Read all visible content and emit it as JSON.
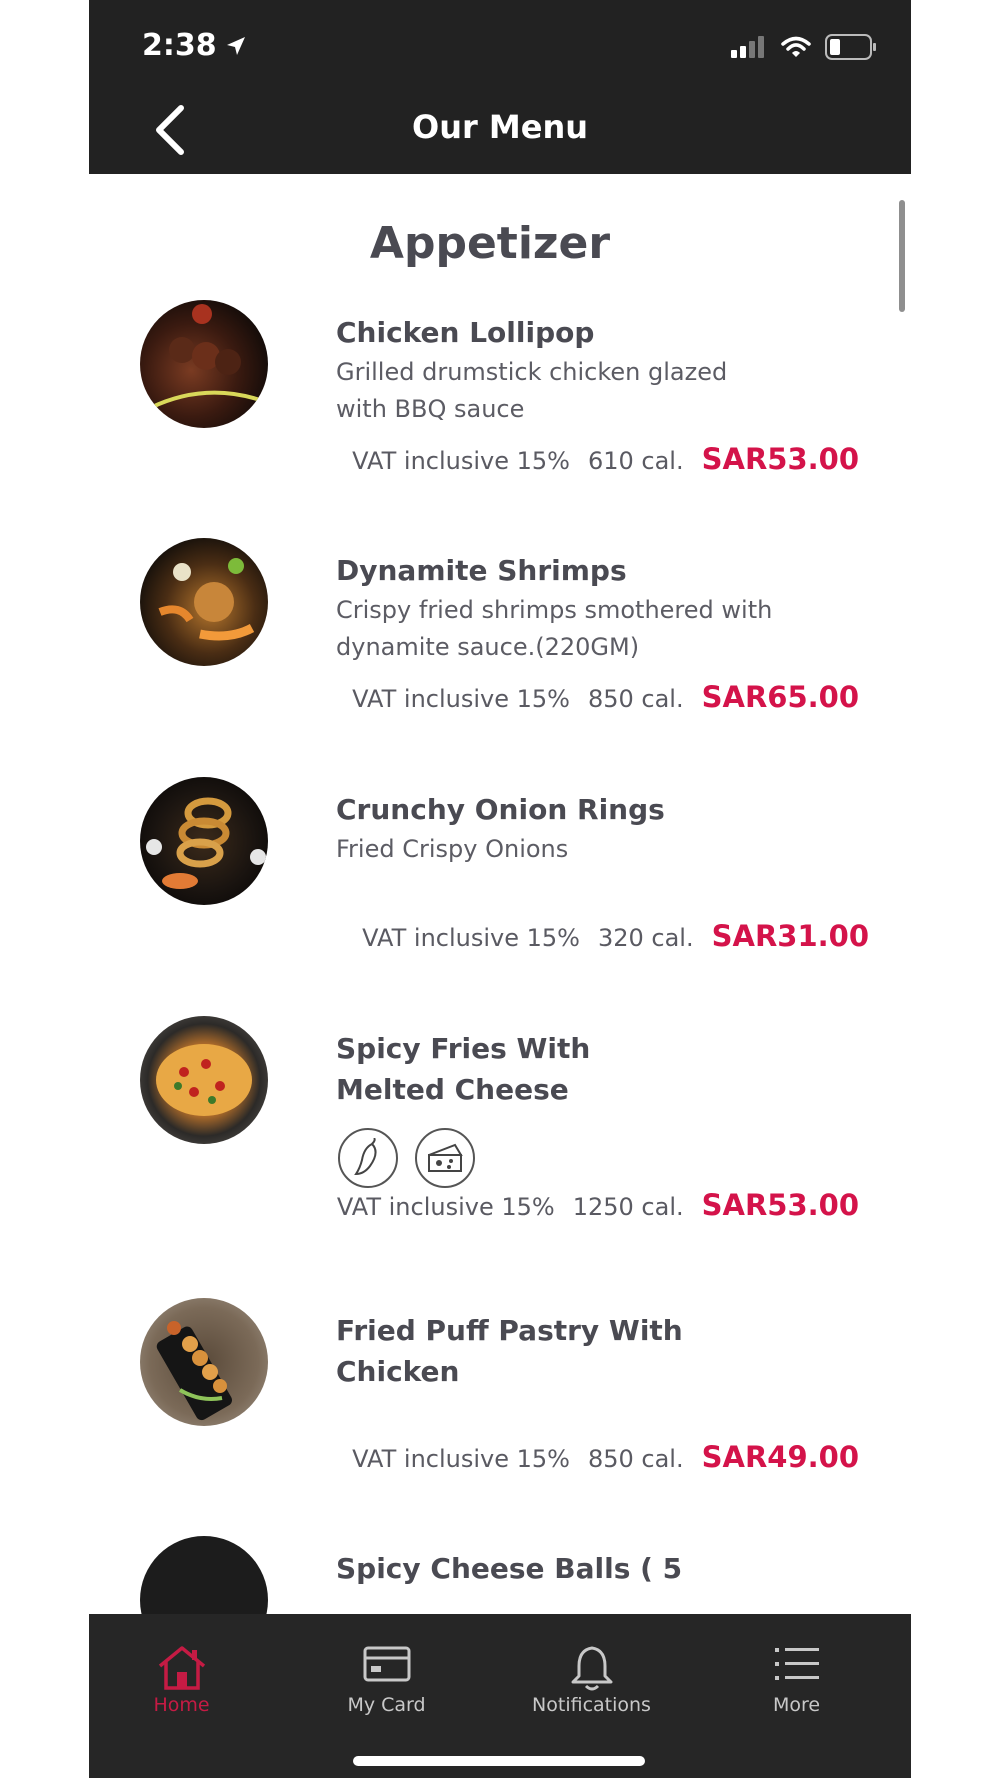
{
  "status": {
    "time": "2:38"
  },
  "header": {
    "title": "Our Menu"
  },
  "section": {
    "title": "Appetizer"
  },
  "items": [
    {
      "name": "Chicken Lollipop",
      "description": "Grilled drumstick chicken glazed with BBQ sauce",
      "vat": "VAT inclusive 15%",
      "calories": "610 cal.",
      "price": "SAR53.00"
    },
    {
      "name": "Dynamite Shrimps",
      "description": "Crispy fried shrimps smothered with dynamite sauce.(220GM)",
      "vat": "VAT inclusive 15%",
      "calories": "850 cal.",
      "price": "SAR65.00"
    },
    {
      "name": "Crunchy Onion Rings",
      "description": "Fried Crispy Onions",
      "vat": "VAT inclusive 15%",
      "calories": "320 cal.",
      "price": "SAR31.00"
    },
    {
      "name": "Spicy Fries With Melted Cheese",
      "description": "",
      "vat": "VAT inclusive 15%",
      "calories": "1250 cal.",
      "price": "SAR53.00",
      "tags": [
        "chili-pepper-icon",
        "cheese-icon"
      ]
    },
    {
      "name": "Fried Puff Pastry With Chicken",
      "description": "",
      "vat": "VAT inclusive 15%",
      "calories": "850 cal.",
      "price": "SAR49.00"
    },
    {
      "name": "Spicy Cheese Balls ( 5"
    }
  ],
  "tabbar": {
    "items": [
      {
        "label": "Home",
        "icon": "home-icon",
        "active": true
      },
      {
        "label": "My Card",
        "icon": "card-icon",
        "active": false
      },
      {
        "label": "Notifications",
        "icon": "bell-icon",
        "active": false
      },
      {
        "label": "More",
        "icon": "list-icon",
        "active": false
      }
    ]
  },
  "colors": {
    "bar": "#222222",
    "accent": "#d4134a",
    "text": "#4a4a52"
  }
}
